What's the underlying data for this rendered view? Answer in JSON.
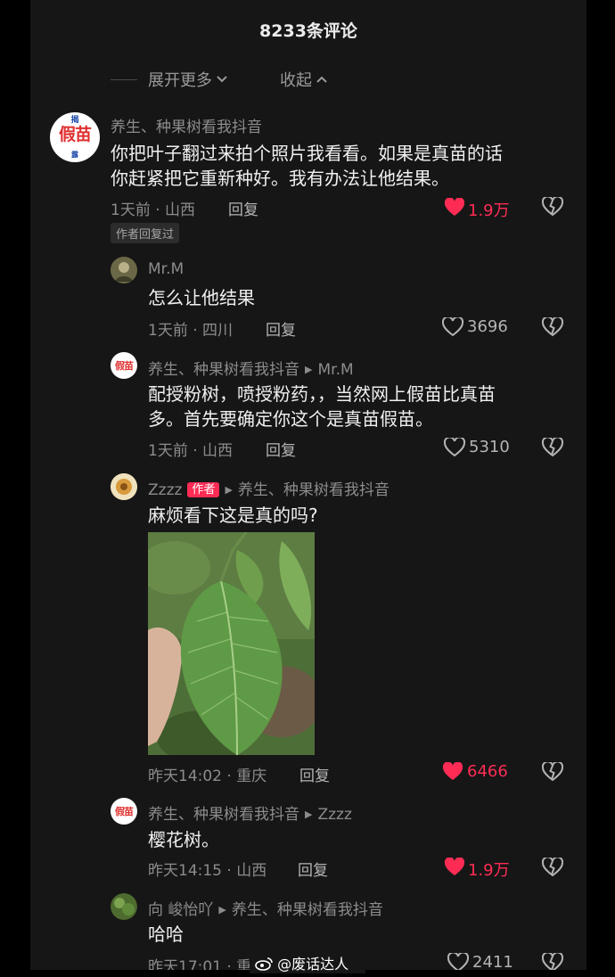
{
  "header": {
    "title": "8233条评论"
  },
  "thread_controls": {
    "expand_more": "展开更多",
    "collapse": "收起"
  },
  "comments": [
    {
      "user": "养生、种果树看我抖音",
      "avatar_text": "假苗",
      "avatar_top_text": "揭",
      "avatar_bottom_text": "露",
      "lines": [
        "你把叶子翻过来拍个照片我看看。如果是真苗的话",
        "你赶紧把它重新种好。我有办法让他结果。"
      ],
      "meta": "1天前 · 山西",
      "reply": "回复",
      "likes": "1.9万",
      "liked": true,
      "badge": "作者回复过"
    }
  ],
  "replies": [
    {
      "user": "Mr.M",
      "content": "怎么让他结果",
      "meta": "1天前 · 四川",
      "reply": "回复",
      "likes": "3696",
      "liked": false
    },
    {
      "user": "养生、种果树看我抖音",
      "reply_to": "Mr.M",
      "avatar_text": "假苗",
      "lines": [
        "配授粉树，喷授粉药，，当然网上假苗比真苗",
        "多。首先要确定你这个是真苗假苗。"
      ],
      "meta": "1天前 · 山西",
      "reply": "回复",
      "likes": "5310",
      "liked": false
    },
    {
      "user": "Zzzz",
      "author_badge": "作者",
      "reply_to": "养生、种果树看我抖音",
      "content": "麻烦看下这是真的吗?",
      "meta": "昨天14:02 · 重庆",
      "reply": "回复",
      "likes": "6466",
      "liked": true
    },
    {
      "user": "养生、种果树看我抖音",
      "reply_to": "Zzzz",
      "avatar_text": "假苗",
      "content": "樱花树。",
      "meta": "昨天14:15 · 山西",
      "reply": "回复",
      "likes": "1.9万",
      "liked": true
    },
    {
      "user": "向 峻怡吖",
      "reply_to": "养生、种果树看我抖音",
      "content": "哈哈",
      "meta": "昨天17:01 · 重",
      "likes": "2411",
      "liked": false
    }
  ],
  "watermark": "@废话达人",
  "colors": {
    "background": "#161616",
    "liked": "#fe2c55",
    "muted": "#8c8c8c",
    "text": "#f0f0f0"
  }
}
